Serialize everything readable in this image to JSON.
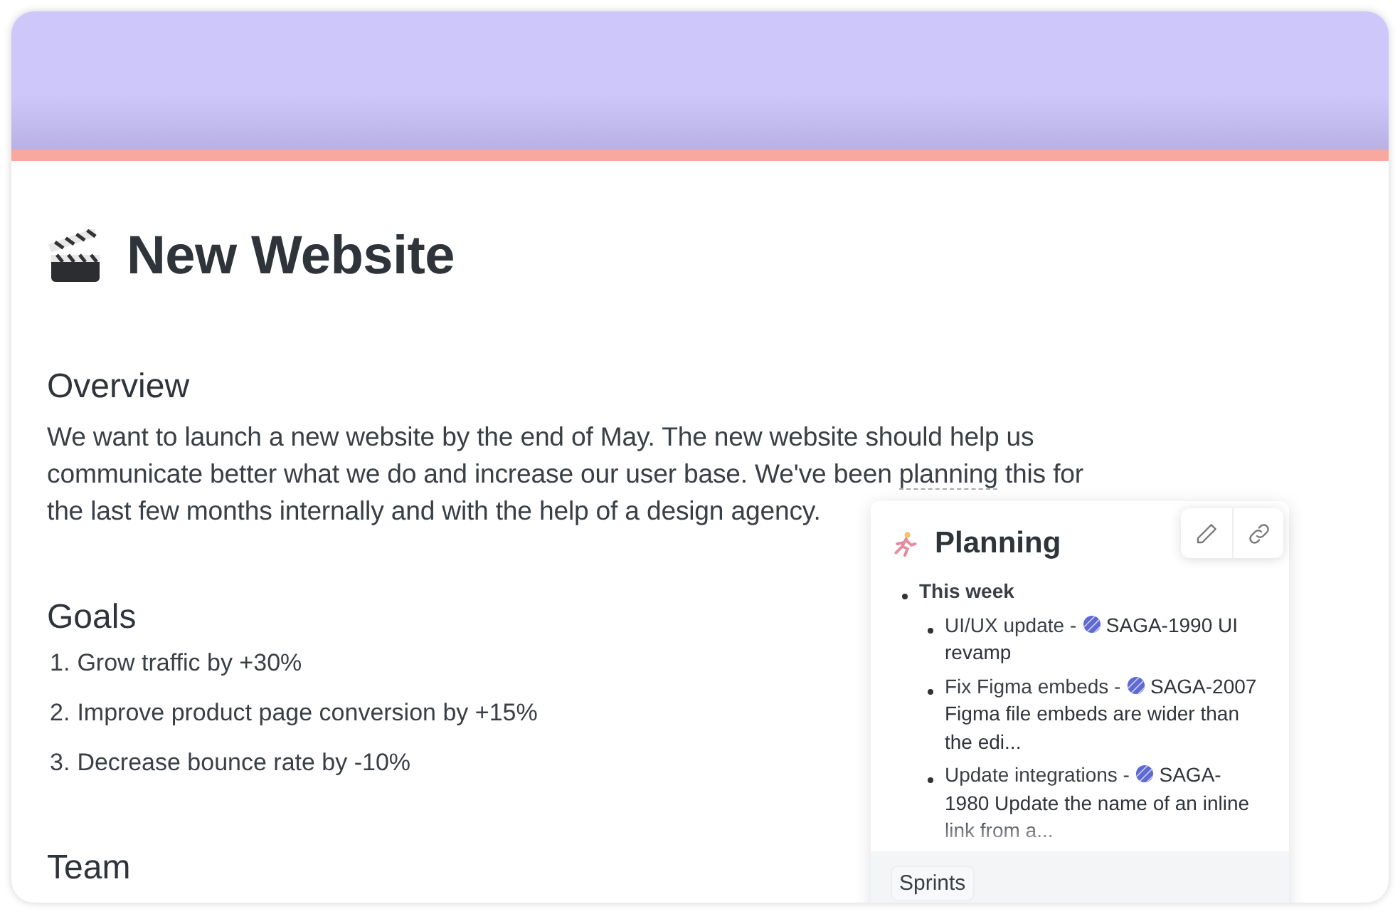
{
  "page": {
    "title": "New Website"
  },
  "sections": [
    {
      "kind": "paragraph",
      "heading": "Overview",
      "text": "We want to launch a new website by the end of May. The new website should help us communicate better what we do and increase our user base. We've been planning this for the last few months internally and with the help of a design agency."
    },
    {
      "kind": "numbered",
      "heading": "Goals",
      "items": [
        {
          "number": "1.",
          "text": "Grow traffic by +30%"
        },
        {
          "number": "2.",
          "text": "Improve product page conversion by +15%"
        },
        {
          "number": "3.",
          "text": "Decrease bounce rate by -10%"
        }
      ]
    },
    {
      "kind": "heading",
      "heading": "Team"
    }
  ],
  "popover": {
    "title": "Planning",
    "group": "This week",
    "tasks": [
      {
        "title": "UI/UX update -",
        "issue": "SAGA-1990 UI revamp"
      },
      {
        "title": "Fix Figma embeds -",
        "issue": "SAGA-2007 Figma file embeds are wider than the edi..."
      },
      {
        "title": "Update integrations -",
        "issue": "SAGA-1980 Update the name of an inline link from a..."
      }
    ],
    "tag": "Sprints"
  }
}
